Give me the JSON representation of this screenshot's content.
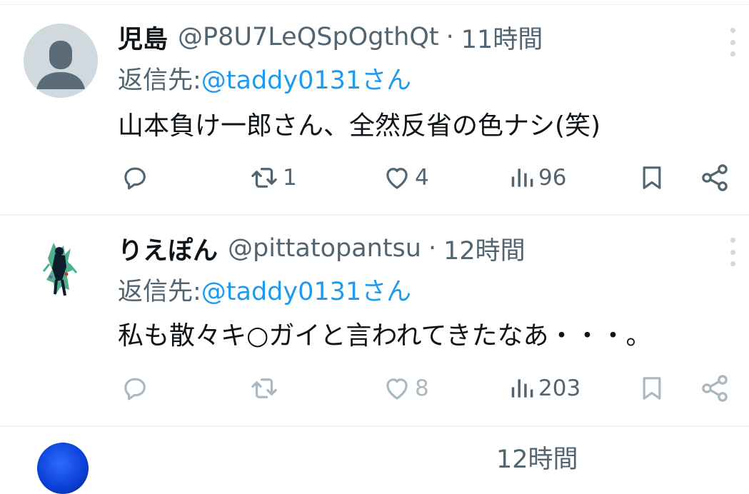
{
  "tweets": [
    {
      "name": "児島",
      "handle": "@P8U7LeQSpOgthQt",
      "separator": "·",
      "time": "11時間",
      "reply_prefix": "返信先: ",
      "reply_target": "@taddy0131さん",
      "text": "山本負け一郎さん、全然反省の色ナシ(笑)",
      "avatar": "default-profile-icon",
      "actions": {
        "reply_icon": "reply-icon",
        "retweet_icon": "retweet-icon",
        "retweets": "1",
        "like_icon": "heart-icon",
        "likes": "4",
        "views_icon": "views-icon",
        "views": "96",
        "bookmark_icon": "bookmark-icon",
        "share_icon": "share-icon"
      }
    },
    {
      "name": "りえぽん",
      "handle": "@pittatopantsu",
      "separator": "·",
      "time": "12時間",
      "reply_prefix": "返信先: ",
      "reply_target": "@taddy0131さん",
      "text": "私も散々キ○ガイと言われてきたなあ・・・。",
      "avatar": "illustration-avatar",
      "actions": {
        "reply_icon": "reply-icon",
        "retweet_icon": "retweet-icon",
        "retweets": "",
        "like_icon": "heart-icon",
        "likes": "8",
        "views_icon": "views-icon",
        "views": "203",
        "bookmark_icon": "bookmark-icon",
        "share_icon": "share-icon"
      }
    }
  ],
  "next_tweet_partial": {
    "time": "12時間"
  },
  "colors": {
    "text": "#0f1419",
    "secondary": "#536471",
    "link": "#1d9bf0",
    "divider": "#eff3f4",
    "faded_icon": "#aab8c2"
  }
}
